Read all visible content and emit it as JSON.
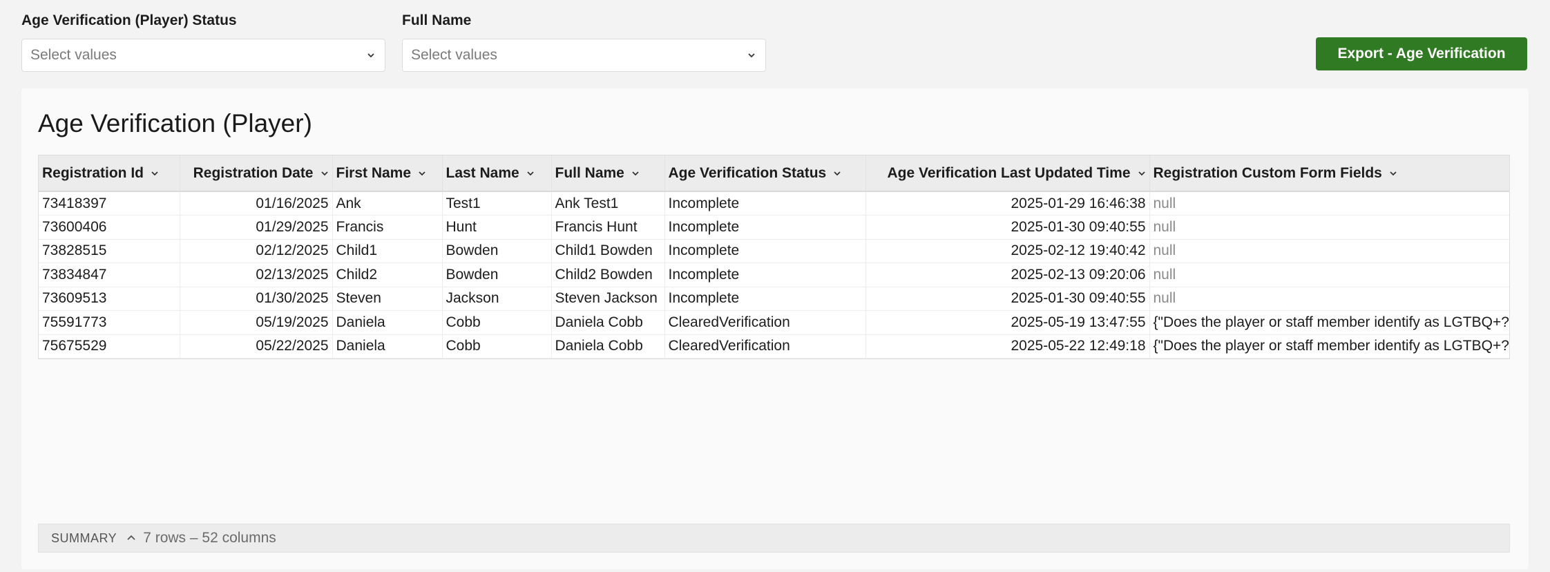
{
  "filters": [
    {
      "label": "Age Verification (Player) Status",
      "placeholder": "Select values"
    },
    {
      "label": "Full Name",
      "placeholder": "Select values"
    }
  ],
  "export_button": "Export - Age Verification",
  "panel": {
    "title": "Age Verification (Player)",
    "columns": [
      "Registration Id",
      "Registration Date",
      "First Name",
      "Last Name",
      "Full Name",
      "Age Verification Status",
      "Age Verification Last Updated Time",
      "Registration Custom Form Fields"
    ],
    "rows": [
      [
        "73418397",
        "01/16/2025",
        "Ank",
        "Test1",
        "Ank Test1",
        "Incomplete",
        "2025-01-29 16:46:38",
        "null"
      ],
      [
        "73600406",
        "01/29/2025",
        "Francis",
        "Hunt",
        "Francis Hunt",
        "Incomplete",
        "2025-01-30 09:40:55",
        "null"
      ],
      [
        "73828515",
        "02/12/2025",
        "Child1",
        "Bowden",
        "Child1 Bowden",
        "Incomplete",
        "2025-02-12 19:40:42",
        "null"
      ],
      [
        "73834847",
        "02/13/2025",
        "Child2",
        "Bowden",
        "Child2 Bowden",
        "Incomplete",
        "2025-02-13 09:20:06",
        "null"
      ],
      [
        "73609513",
        "01/30/2025",
        "Steven",
        "Jackson",
        "Steven Jackson",
        "Incomplete",
        "2025-01-30 09:40:55",
        "null"
      ],
      [
        "75591773",
        "05/19/2025",
        "Daniela",
        "Cobb",
        "Daniela Cobb",
        "ClearedVerification",
        "2025-05-19 13:47:55",
        "{\"Does the player or staff member identify as LGTBQ+?"
      ],
      [
        "75675529",
        "05/22/2025",
        "Daniela",
        "Cobb",
        "Daniela Cobb",
        "ClearedVerification",
        "2025-05-22 12:49:18",
        "{\"Does the player or staff member identify as LGTBQ+?"
      ]
    ]
  },
  "summary": {
    "label": "SUMMARY",
    "count": "7 rows – 52 columns"
  },
  "colors": {
    "accent": "#2f7a22",
    "background": "#f3f3f3",
    "header": "#ececec"
  }
}
